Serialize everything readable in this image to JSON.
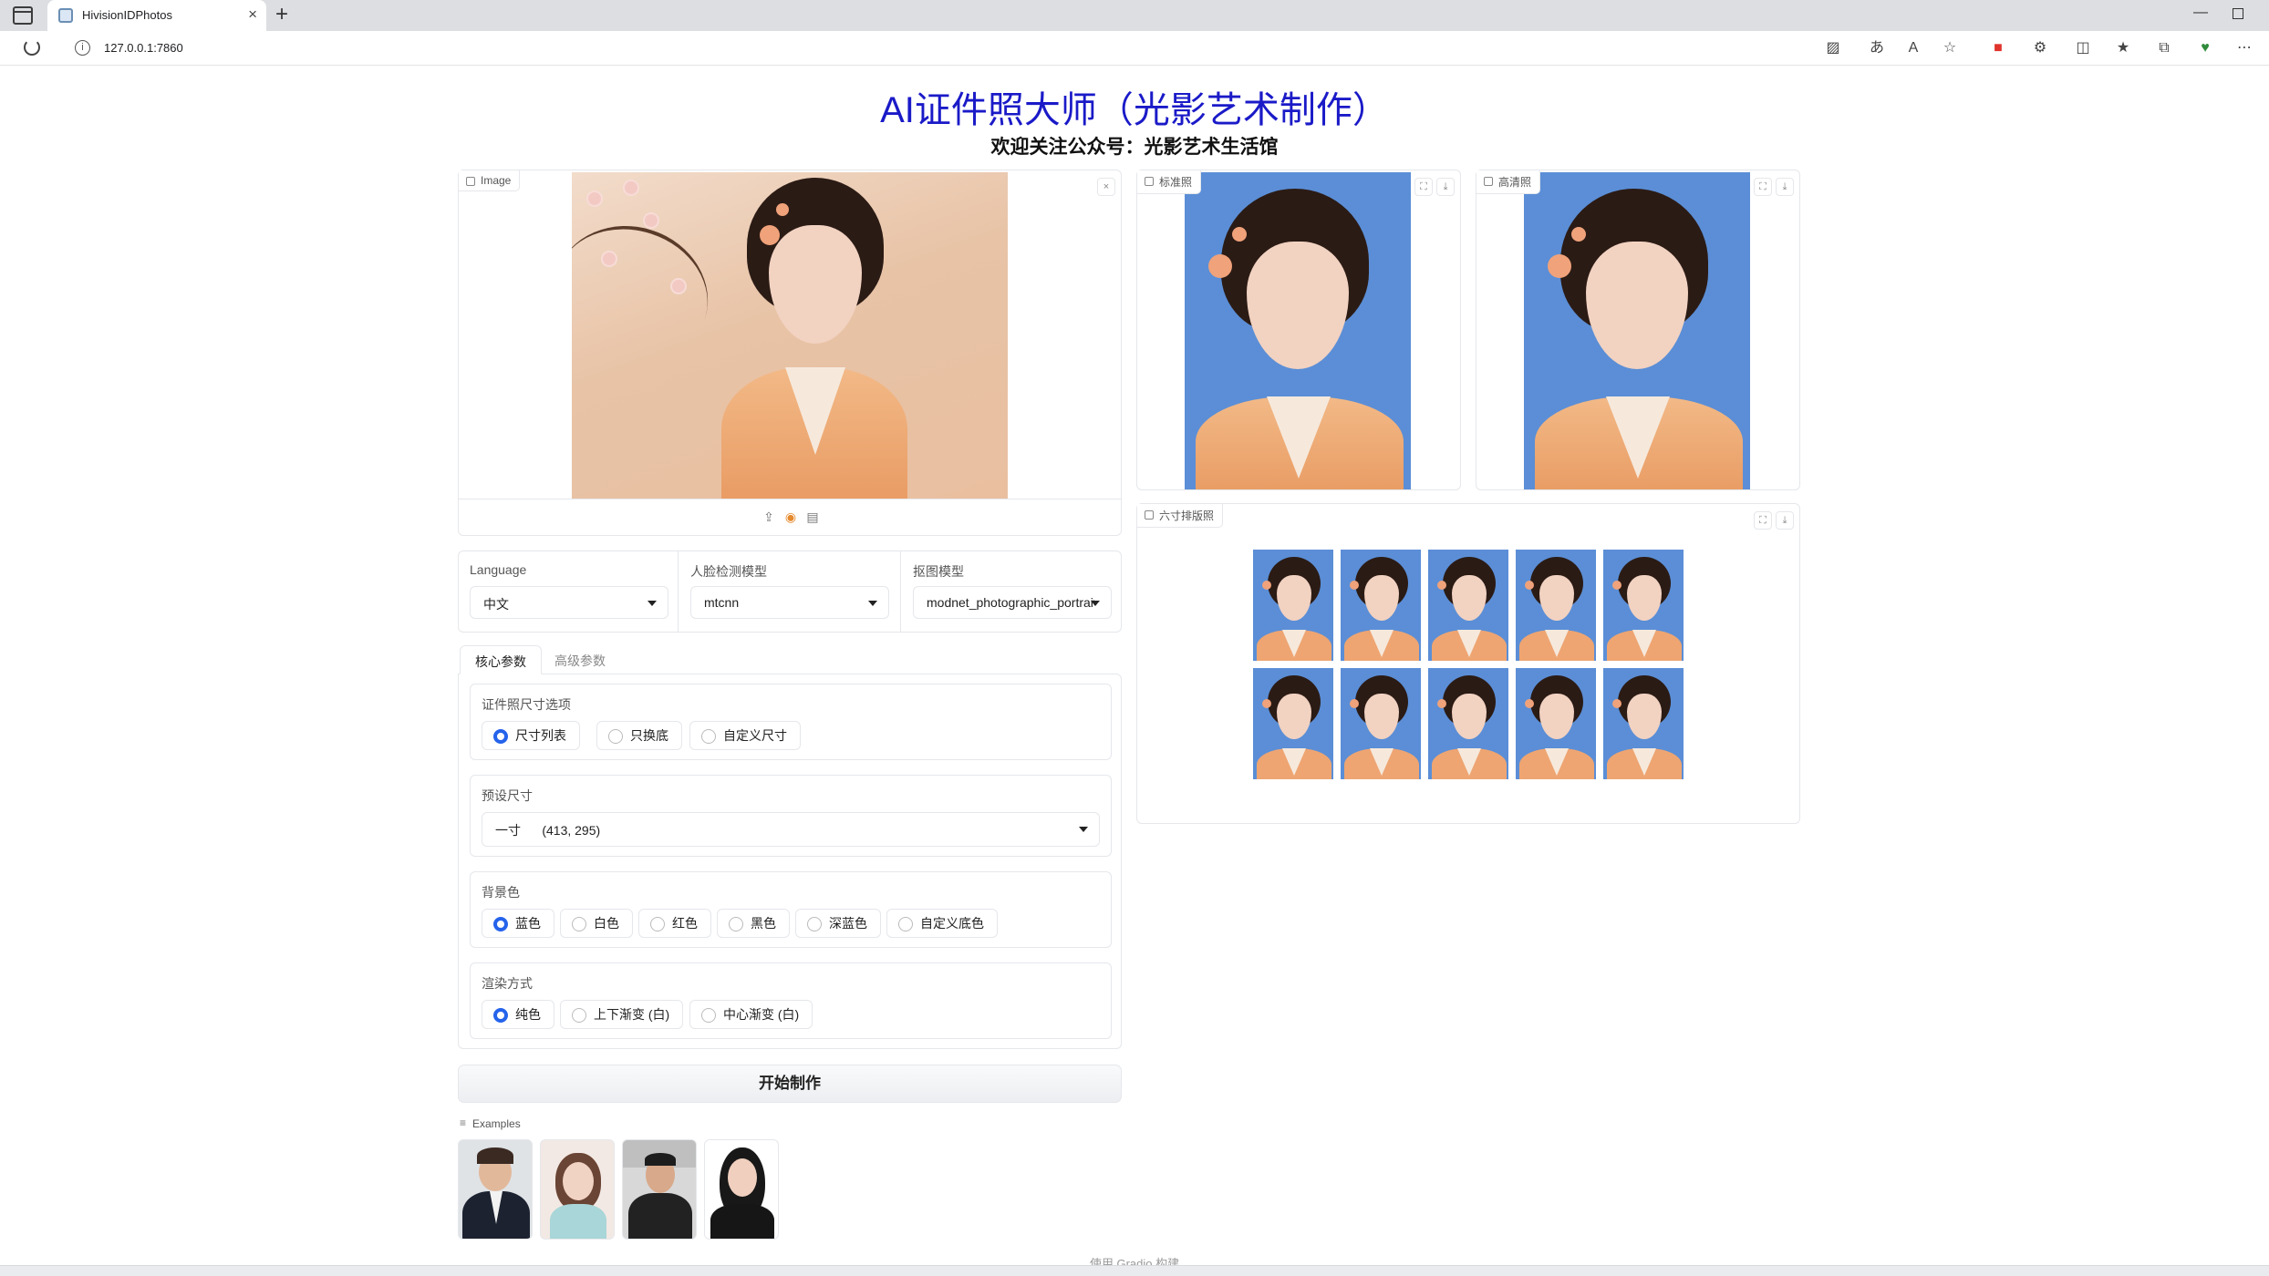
{
  "browser": {
    "tab_title": "HivisionIDPhotos",
    "url": "127.0.0.1:7860",
    "toolbar_icons": [
      "no-image-icon",
      "translate-icon",
      "read-aloud-icon",
      "favorite-star-icon",
      "extension-red-icon",
      "extensions-icon",
      "split-screen-icon",
      "favorites-icon",
      "collections-icon",
      "browser-essentials-icon",
      "more-icon"
    ]
  },
  "header": {
    "title": "AI证件照大师（光影艺术制作）",
    "subtitle": "欢迎关注公众号：光影艺术生活馆"
  },
  "input_image": {
    "label": "Image"
  },
  "outputs": {
    "standard_label": "标准照",
    "hd_label": "高清照",
    "layout_label": "六寸排版照",
    "layout_grid": {
      "rows": 2,
      "cols": 5
    }
  },
  "selectors": {
    "language": {
      "label": "Language",
      "value": "中文"
    },
    "face_model": {
      "label": "人脸检测模型",
      "value": "mtcnn"
    },
    "matting_model": {
      "label": "抠图模型",
      "value": "modnet_photographic_portrait_matting"
    }
  },
  "tabs": {
    "core": "核心参数",
    "advanced": "高级参数"
  },
  "size_option": {
    "label": "证件照尺寸选项",
    "options": [
      "尺寸列表",
      "只换底",
      "自定义尺寸"
    ],
    "selected": 0
  },
  "preset_size": {
    "label": "预设尺寸",
    "value": "一寸      (413, 295)"
  },
  "background": {
    "label": "背景色",
    "options": [
      "蓝色",
      "白色",
      "红色",
      "黑色",
      "深蓝色",
      "自定义底色"
    ],
    "selected": 0,
    "blue_hex": "#5b8ed6"
  },
  "render": {
    "label": "渲染方式",
    "options": [
      "纯色",
      "上下渐变 (白)",
      "中心渐变 (白)"
    ],
    "selected": 0
  },
  "run_button": "开始制作",
  "examples": {
    "label": "Examples"
  },
  "footer": "使用 Gradio 构建",
  "colors": {
    "title": "#1a1ac8",
    "accent": "#2563eb"
  }
}
